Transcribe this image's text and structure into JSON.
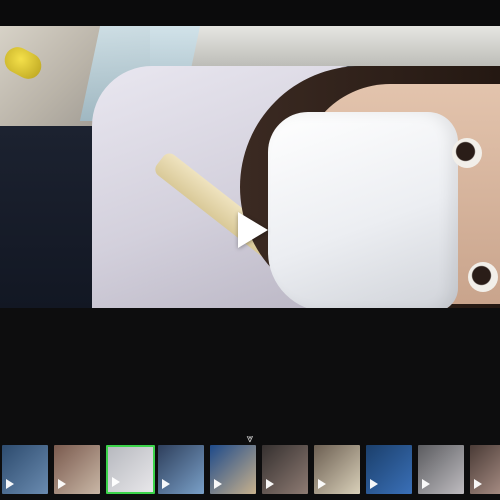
{
  "viewer": {
    "play_icon": "play-icon",
    "expand_icon": "chevron-double-down-icon"
  },
  "filmstrip": {
    "selected_index": 2,
    "selected_border_color": "#3bd34a",
    "thumbnails": [
      {
        "colors": [
          "#2d4b6e",
          "#6a8bb0"
        ]
      },
      {
        "colors": [
          "#7a5a4e",
          "#c9b7a6"
        ]
      },
      {
        "colors": [
          "#b7b9bf",
          "#e8e7ea"
        ]
      },
      {
        "colors": [
          "#2e3f5c",
          "#7aa0c8"
        ]
      },
      {
        "colors": [
          "#1e4a8a",
          "#c8b18c"
        ]
      },
      {
        "colors": [
          "#35302f",
          "#8e7b73"
        ]
      },
      {
        "colors": [
          "#6c5f52",
          "#d9d0b9"
        ]
      },
      {
        "colors": [
          "#1b3f6b",
          "#3a70b8"
        ]
      },
      {
        "colors": [
          "#5b5c60",
          "#bfbcc0"
        ]
      },
      {
        "colors": [
          "#4a3b36",
          "#b69a90"
        ]
      }
    ]
  }
}
